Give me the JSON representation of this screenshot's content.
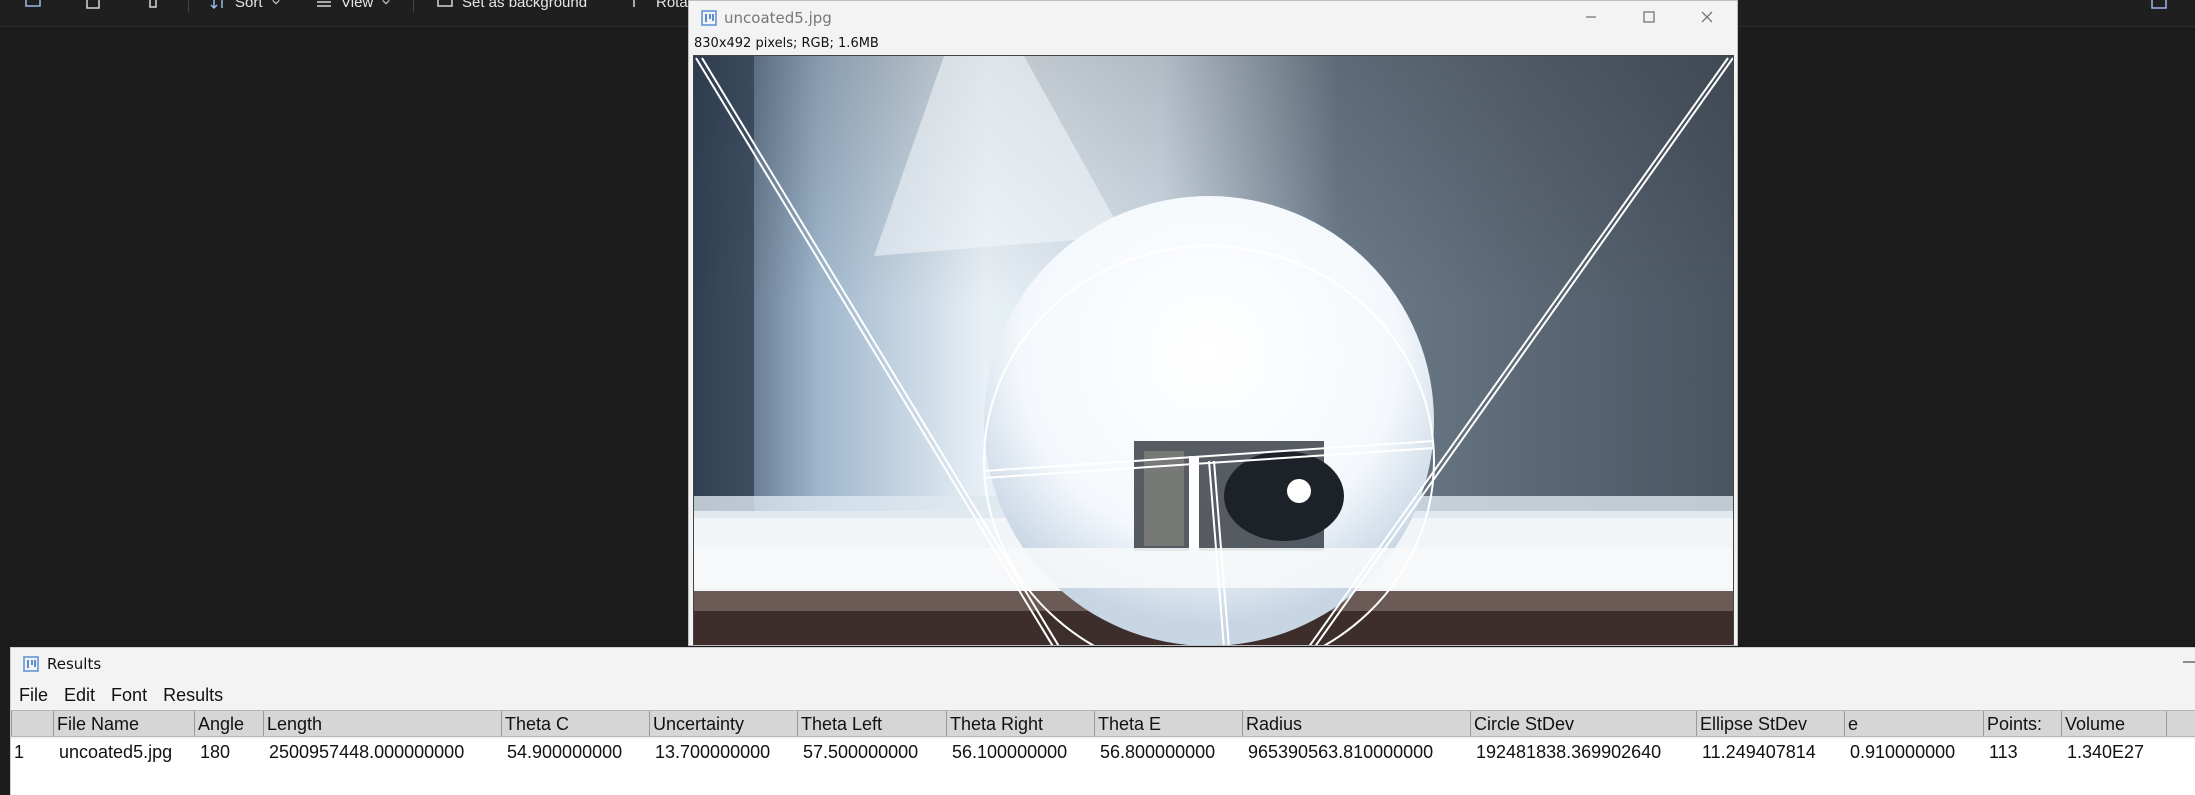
{
  "toolbar": {
    "sort_label": "Sort",
    "view_label": "View",
    "background_label": "Set as background",
    "rotate_label": "Rota"
  },
  "image_window": {
    "title": "uncoated5.jpg",
    "info": "830x492 pixels; RGB; 1.6MB"
  },
  "results_window": {
    "title": "Results",
    "menu": [
      "File",
      "Edit",
      "Font",
      "Results"
    ],
    "columns": [
      "",
      "File Name",
      "Angle",
      "Length",
      "Theta C",
      "Uncertainty",
      "Theta Left",
      "Theta Right",
      "Theta E",
      "Radius",
      "Circle StDev",
      "Ellipse StDev",
      "e",
      "Points:",
      "Volume"
    ],
    "rows": [
      [
        "1",
        "uncoated5.jpg",
        "180",
        "2500957448.000000000",
        "54.900000000",
        "13.700000000",
        "57.500000000",
        "56.100000000",
        "56.800000000",
        "965390563.810000000",
        "192481838.369902640",
        "11.249407814",
        "0.910000000",
        "113",
        "1.340E27"
      ]
    ]
  },
  "colors": {
    "dark_bg": "#1c1c1c",
    "window_bg": "#f3f3f3",
    "table_header": "#d6d6d6"
  }
}
